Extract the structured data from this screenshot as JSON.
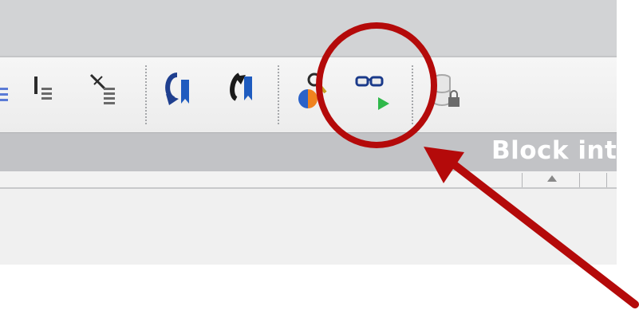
{
  "section": {
    "title": "Block inte"
  },
  "annotation": {
    "color": "#b40a0a"
  }
}
